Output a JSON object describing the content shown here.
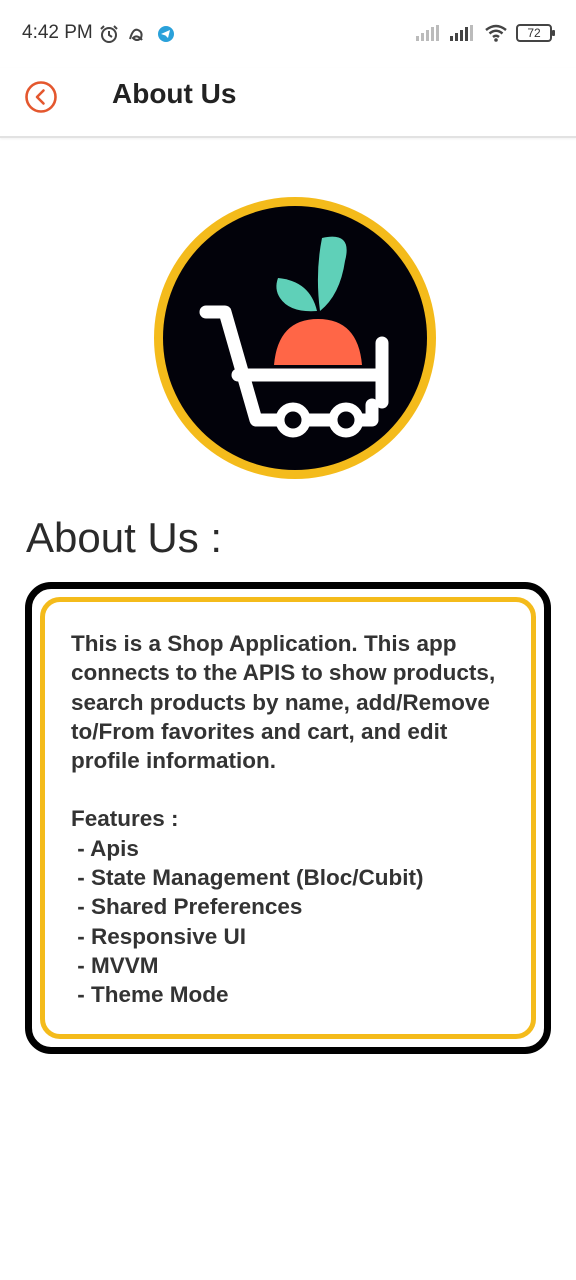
{
  "status_bar": {
    "time": "4:42 PM",
    "battery": "72",
    "left_icons": [
      "alarm-icon",
      "notification-icon",
      "telegram-icon"
    ],
    "right_icons": [
      "signal-icon",
      "signal-icon",
      "wifi-icon",
      "battery-icon"
    ]
  },
  "app_bar": {
    "title": "About Us",
    "back_icon": "back-arrow-circle-icon",
    "accent_color": "#e4572e"
  },
  "logo": {
    "icon": "shopping-cart-with-carrot-icon",
    "ring_color": "#f4bb1b",
    "background_color": "#02020a",
    "leaf_color": "#5fd0b8",
    "carrot_color": "#ff6647"
  },
  "main": {
    "section_title": "About Us :",
    "description": "This is a Shop Application. This app connects to the APIS to show products, search products by name, add/Remove to/From favorites and cart, and edit profile information.",
    "features_title": "Features :",
    "features": [
      " - Apis",
      " - State Management (Bloc/Cubit)",
      " - Shared Preferences",
      " - Responsive UI",
      " - MVVM",
      " - Theme Mode"
    ],
    "card_border_color": "#000000",
    "card_inner_border_color": "#f4bb1b"
  }
}
